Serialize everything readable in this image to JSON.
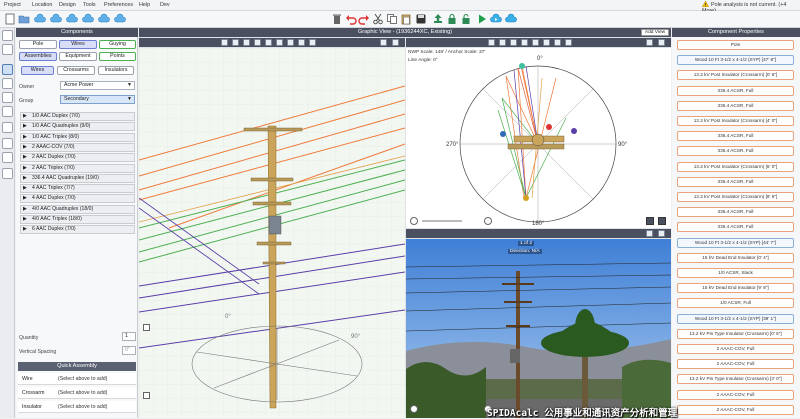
{
  "menu": [
    "Project",
    "Location",
    "Design",
    "Tools",
    "Preferences",
    "Help",
    "Dev"
  ],
  "status_warning": "Pole analysis is not current. (+4 More)",
  "components": {
    "title": "Components",
    "top_tabs": [
      "Pole",
      "Wires",
      "Guying"
    ],
    "sub_tabs": [
      "Assemblies",
      "Equipment",
      "Points"
    ],
    "wire_tabs": [
      "Wires",
      "Crossarms",
      "Insulators"
    ],
    "owner_label": "Owner",
    "owner_value": "Acme Power",
    "group_label": "Group",
    "group_value": "Secondary",
    "wires": [
      "1/0 AAC Duplex (7/0)",
      "1/0 AAC Quadruplex (9/0)",
      "1/0 AAC Triplex (8/0)",
      "2 AAAC-COV (7/0)",
      "2 AAC Duplex (7/0)",
      "2 AAC Triplex (7/0)",
      "336.4 AAC Quadruplex (19/0)",
      "4 AAC Triplex (7/7)",
      "4 AAC Duplex (7/0)",
      "4/0 AAC Quadruplex (18/0)",
      "4/0 AAC Triplex (18/0)",
      "6 AAC Duplex (7/0)"
    ],
    "quantity_label": "Quantity",
    "quantity_value": "1",
    "vspacing_label": "Vertical Spacing",
    "vspacing_value": "0\"",
    "quick_assembly_title": "Quick Assembly",
    "quick_rows": [
      {
        "k": "Wire",
        "v": "(Select above to add)"
      },
      {
        "k": "Crossarm",
        "v": "(Select above to add)"
      },
      {
        "k": "Insulator",
        "v": "(Select above to add)"
      }
    ]
  },
  "graphic": {
    "title": "Graphic View - (1936244XC, Existing)",
    "add_view": "Add View",
    "scale_text": "NWP Scale: 148' / Anchor Scale: 37'",
    "lean_text": "Line Angle: 0°",
    "compass": {
      "n": "0°",
      "e": "90°",
      "s": "180°",
      "w": "270°"
    },
    "photo_counter": "1 of 2",
    "photo_dir": "Direction: N/A"
  },
  "properties": {
    "title": "Component Properties",
    "items": [
      "Pole",
      "Wood 10 Ft 3-1/2 x 4-1/2 (SYP) [47' 8\"]",
      "13.2 kV Post Insulator (Crossarm) [0' 6\"]",
      "336.4 ACSR, Full",
      "336.4 ACSR, Full",
      "13.2 kV Post Insulator (Crossarm) [4' 0\"]",
      "336.4 ACSR, Full",
      "336.4 ACSR, Full",
      "13.2 kV Post Insulator (Crossarm) [6' 0\"]",
      "336.4 ACSR, Full",
      "13.2 kV Post Insulator (Crossarm) [8' 6\"]",
      "336.4 ACSR, Full",
      "336.4 ACSR, Full",
      "Wood 10 Ft 3-1/2 x 4-1/2 (SYP) [44' 7\"]",
      "15 kV Dead End Insulator [0' 4\"]",
      "1/0 ACSR, Slack",
      "15 kV Dead End Insulator [9' 8\"]",
      "1/0 ACSR, Full",
      "Wood 10 Ft 3-1/2 x 4-1/2 (SYP) [39' 1\"]",
      "13.2 kV Pin Type Insulator (Crossarm) [0' 6\"]",
      "2 AAAC-COV, Full",
      "2 AAAC-COV, Full",
      "13.2 kV Pin Type Insulator (Crossarm) [3' 0\"]",
      "2 AAAC-COV, Full",
      "2 AAAC-COV, Full"
    ]
  },
  "watermark": "SPIDAcalc 公用事业和通讯资产分析和管理",
  "colors": {
    "header": "#4a5060",
    "accent": "#4caf50",
    "wire_orange": "#f07a3a",
    "wire_green": "#4caf50",
    "wire_purple": "#5a3ea8",
    "pole": "#c9a45a"
  }
}
